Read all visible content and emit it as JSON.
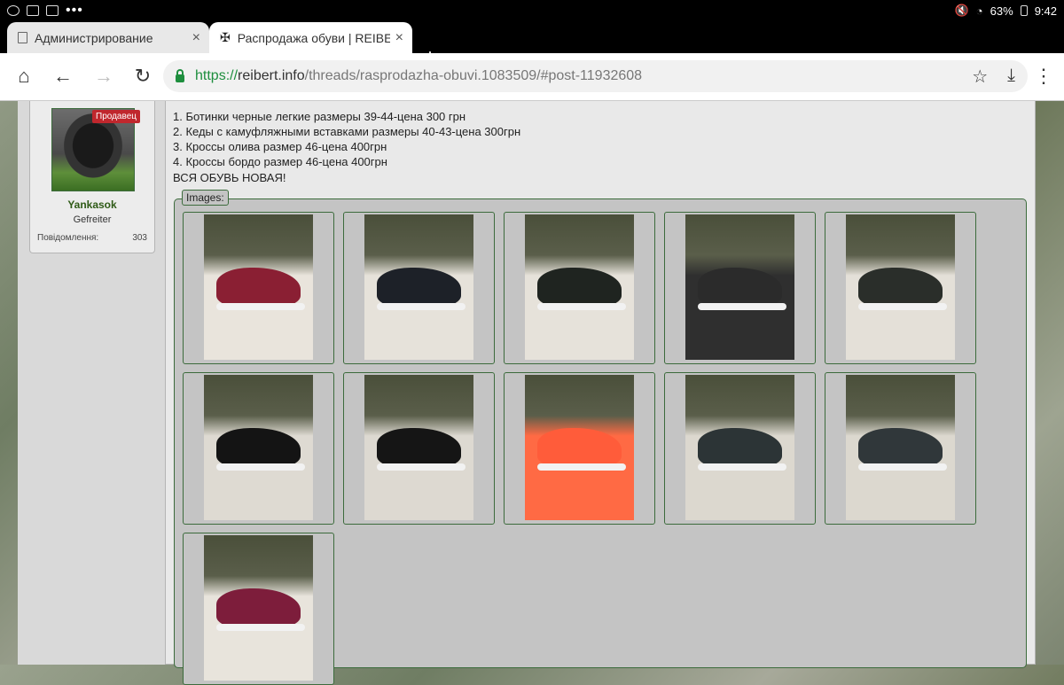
{
  "statusbar": {
    "battery": "63%",
    "time": "9:42",
    "more": "•••"
  },
  "tabs": [
    {
      "title": "Администрирование",
      "icon": "document-icon",
      "close": "×"
    },
    {
      "title": "Распродажа обуви | REIBER",
      "icon": "iron-cross-icon",
      "close": "×"
    }
  ],
  "toolbar": {
    "new_tab": "+",
    "url_scheme": "https://",
    "url_host": "reibert.info",
    "url_path": "/threads/rasprodazha-obuvi.1083509/#post-11932608"
  },
  "user": {
    "badge": "Продавец",
    "name": "Yankasok",
    "title": "Gefreiter",
    "posts_label": "Повідомлення:",
    "posts_value": "303"
  },
  "post": {
    "lines": [
      "1. Ботинки черные легкие размеры 39-44-цена 300 грн",
      "2. Кеды с камуфляжными вставками размеры 40-43-цена 300грн",
      "3. Кроссы олива размер 46-цена 400грн",
      "4. Кроссы бордо размер 46-цена 400грн",
      "ВСЯ ОБУВЬ НОВАЯ!"
    ],
    "images_label": "Images:"
  },
  "thumbnails": [
    {
      "shoe": "#8a1f33",
      "bg": "#e9e4dc"
    },
    {
      "shoe": "#1d2128",
      "bg": "#e6e2da"
    },
    {
      "shoe": "#1f2420",
      "bg": "#e6e2da"
    },
    {
      "shoe": "#2b2b2b",
      "bg": "#2f2f2f"
    },
    {
      "shoe": "#2a2e2a",
      "bg": "#e4e0d8"
    },
    {
      "shoe": "#141414",
      "bg": "#dedad2"
    },
    {
      "shoe": "#151515",
      "bg": "#ddd9d1"
    },
    {
      "shoe": "#ff5c3a",
      "bg": "#ff6a44"
    },
    {
      "shoe": "#2c3436",
      "bg": "#dcd8cf"
    },
    {
      "shoe": "#30373a",
      "bg": "#dcd8cf"
    },
    {
      "shoe": "#7d1d3b",
      "bg": "#e8e4dc"
    }
  ],
  "colors": {
    "accent_green": "#1e8e3e",
    "badge_red": "#c0272d",
    "username_green": "#2e5a16"
  }
}
